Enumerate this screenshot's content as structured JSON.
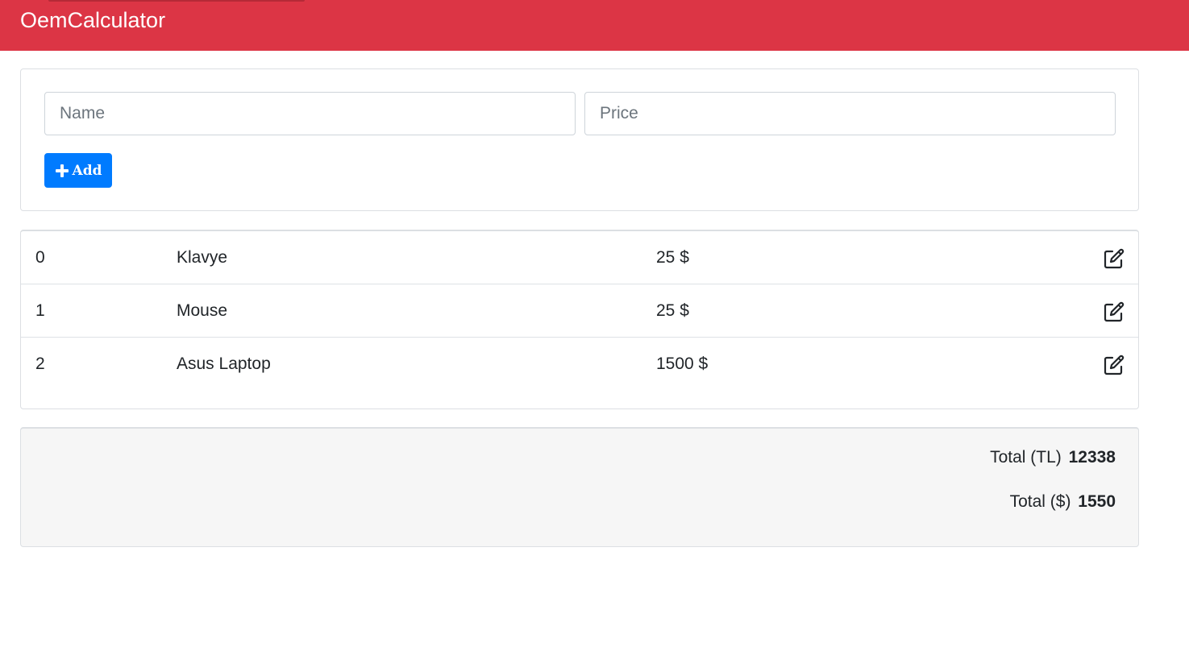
{
  "app": {
    "brand": "OemCalculator",
    "accent_color": "#dc3545"
  },
  "form": {
    "name_placeholder": "Name",
    "price_placeholder": "Price",
    "add_label": "Add",
    "add_icon": "plus-icon",
    "button_color": "#007bff"
  },
  "items": [
    {
      "index": "0",
      "name": "Klavye",
      "price": "25 $",
      "action_icon": "edit-icon"
    },
    {
      "index": "1",
      "name": "Mouse",
      "price": "25 $",
      "action_icon": "edit-icon"
    },
    {
      "index": "2",
      "name": "Asus Laptop",
      "price": "1500 $",
      "action_icon": "edit-icon"
    }
  ],
  "totals": {
    "tl_label": "Total (TL)",
    "tl_value": "12338",
    "usd_label": "Total ($)",
    "usd_value": "1550"
  }
}
